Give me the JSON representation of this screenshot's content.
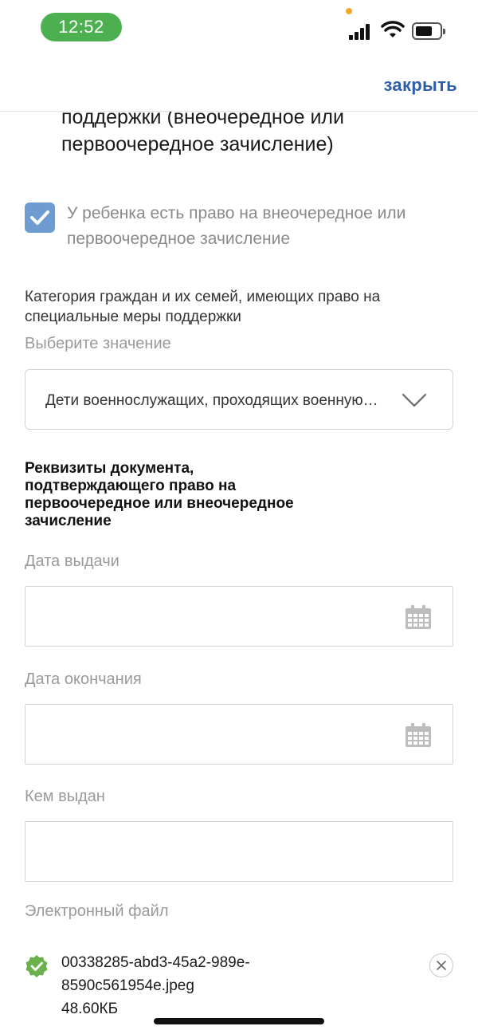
{
  "status_bar": {
    "time": "12:52"
  },
  "top_bar": {
    "close_label": "закрыть"
  },
  "heading_partial": "поддержки (внеочередное или первоочередное зачисление)",
  "priority_checkbox": {
    "checked": true,
    "label": "У ребенка есть право на внеочередное или первоочередное зачисление"
  },
  "category": {
    "label": "Категория граждан и их семей, имеющих право на специальные меры поддержки",
    "hint": "Выберите значение",
    "selected_value": "Дети военнослужащих, проходящих военную службу"
  },
  "document_section": {
    "title": "Реквизиты документа, подтверждающего право на первоочередное или внеочередное зачисление",
    "issue_date_label": "Дата выдачи",
    "end_date_label": "Дата окончания",
    "issued_by_label": "Кем выдан",
    "file_label": "Электронный файл"
  },
  "file": {
    "name": "00338285-abd3-45a2-989e-8590c561954e.jpeg",
    "size": "48.60КБ"
  },
  "colors": {
    "accent_blue": "#2f5fa8",
    "checkbox_blue": "#6e9bd0",
    "success_green": "#6ab04c",
    "time_pill_green": "#4caf50"
  }
}
